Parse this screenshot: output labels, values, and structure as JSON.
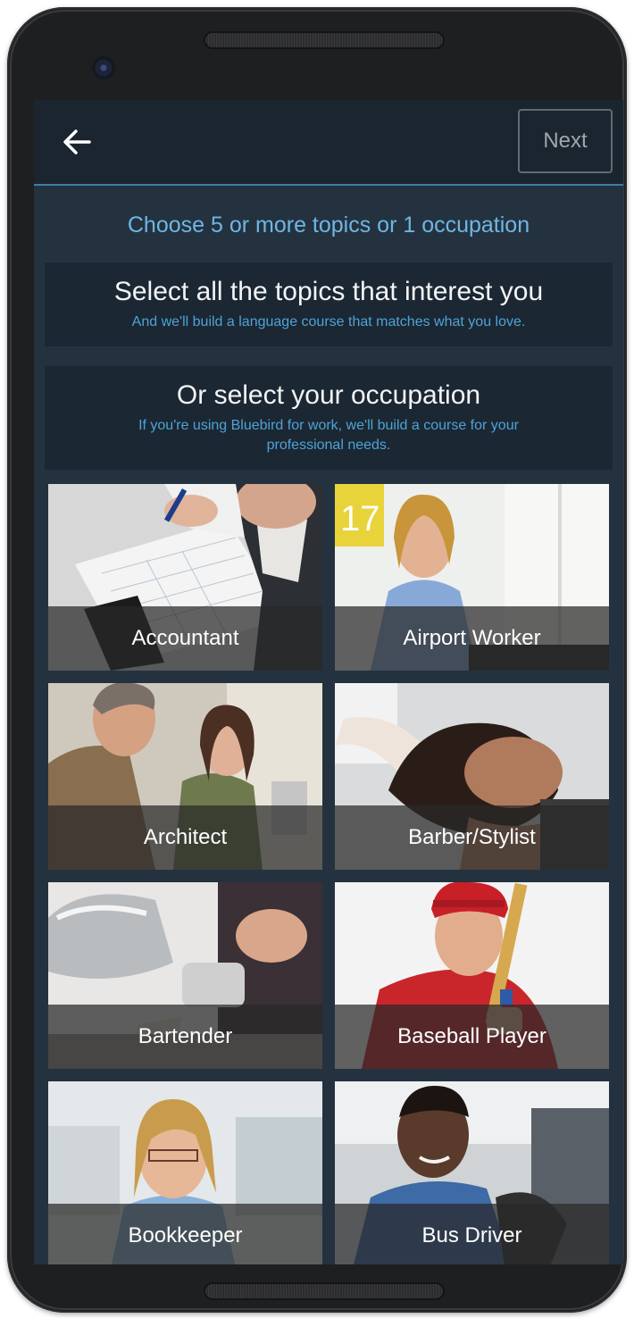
{
  "header": {
    "back_icon": "arrow-left-icon",
    "next_label": "Next"
  },
  "instruction": "Choose 5 or more topics or 1 occupation",
  "topics_panel": {
    "title": "Select all the topics that interest you",
    "subtitle": "And we'll build a language course that matches what you love."
  },
  "occupation_panel": {
    "title": "Or select your occupation",
    "subtitle": "If you're using Bluebird for work, we'll build a course for your professional needs."
  },
  "occupations": [
    {
      "label": "Accountant"
    },
    {
      "label": "Airport Worker"
    },
    {
      "label": "Architect"
    },
    {
      "label": "Barber/Stylist"
    },
    {
      "label": "Bartender"
    },
    {
      "label": "Baseball Player"
    },
    {
      "label": "Bookkeeper"
    },
    {
      "label": "Bus Driver"
    }
  ],
  "colors": {
    "accent": "#6fb6e3",
    "background": "#243240",
    "panel": "#1b2732"
  }
}
